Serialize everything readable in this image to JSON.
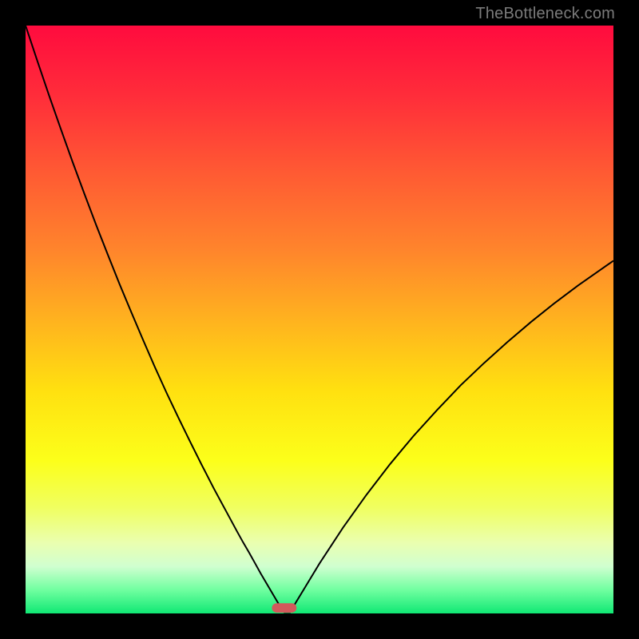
{
  "watermark": "TheBottleneck.com",
  "gradient": {
    "stops": [
      {
        "offset": 0.0,
        "color": "#ff0b3e"
      },
      {
        "offset": 0.12,
        "color": "#ff2d3a"
      },
      {
        "offset": 0.25,
        "color": "#ff5a33"
      },
      {
        "offset": 0.38,
        "color": "#ff842c"
      },
      {
        "offset": 0.5,
        "color": "#ffb21f"
      },
      {
        "offset": 0.62,
        "color": "#ffe010"
      },
      {
        "offset": 0.74,
        "color": "#fcff1a"
      },
      {
        "offset": 0.82,
        "color": "#f0ff60"
      },
      {
        "offset": 0.88,
        "color": "#eaffb0"
      },
      {
        "offset": 0.92,
        "color": "#d0ffd0"
      },
      {
        "offset": 0.96,
        "color": "#70ffa0"
      },
      {
        "offset": 1.0,
        "color": "#10e874"
      }
    ]
  },
  "chart_data": {
    "type": "line",
    "title": "",
    "xlabel": "",
    "ylabel": "",
    "xlim": [
      0,
      100
    ],
    "ylim": [
      0,
      100
    ],
    "x": [
      0,
      2,
      4,
      6,
      8,
      10,
      12,
      14,
      16,
      18,
      20,
      22,
      24,
      26,
      28,
      30,
      32,
      34,
      36,
      37,
      38,
      39,
      40,
      41,
      42,
      43,
      44,
      45,
      46,
      48,
      50,
      54,
      58,
      62,
      66,
      70,
      74,
      78,
      82,
      86,
      90,
      94,
      98,
      100
    ],
    "values": [
      100,
      94.0,
      88.1,
      82.4,
      76.8,
      71.4,
      66.1,
      61.0,
      56.0,
      51.2,
      46.5,
      41.9,
      37.5,
      33.3,
      29.2,
      25.2,
      21.3,
      17.6,
      13.9,
      12.1,
      10.4,
      8.6,
      6.8,
      5.1,
      3.4,
      1.7,
      0.2,
      0.2,
      1.9,
      5.2,
      8.5,
      14.6,
      20.2,
      25.4,
      30.2,
      34.6,
      38.8,
      42.6,
      46.2,
      49.6,
      52.8,
      55.8,
      58.6,
      60.0
    ],
    "marker": {
      "x": 44.0,
      "width": 4.2,
      "height": 1.6,
      "color": "#d2595b"
    }
  }
}
